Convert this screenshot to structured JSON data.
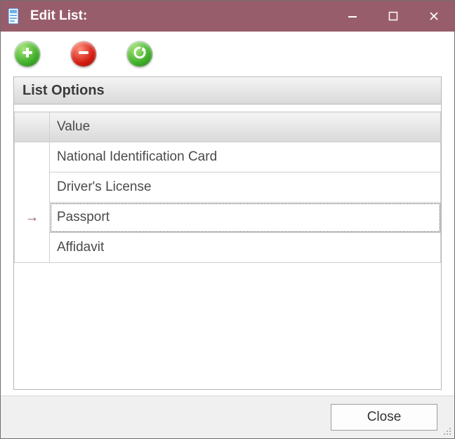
{
  "window": {
    "title": "Edit List:",
    "icons": {
      "app": "list-document-icon",
      "minimize": "minimize-icon",
      "maximize": "maximize-icon",
      "close": "close-icon"
    }
  },
  "toolbar": {
    "add": {
      "name": "add-button",
      "icon": "plus-icon",
      "color": "#3fae2a"
    },
    "remove": {
      "name": "remove-button",
      "icon": "minus-icon",
      "color": "#d11b0f"
    },
    "refresh": {
      "name": "refresh-button",
      "icon": "refresh-icon",
      "color": "#3fae2a"
    }
  },
  "panel": {
    "title": "List Options",
    "columns": {
      "indicator": "",
      "value": "Value"
    },
    "rows": [
      {
        "value": "National Identification Card",
        "selected": false
      },
      {
        "value": "Driver's License",
        "selected": false
      },
      {
        "value": "Passport",
        "selected": true
      },
      {
        "value": "Affidavit",
        "selected": false
      }
    ],
    "indicator_glyph": "→"
  },
  "footer": {
    "close_label": "Close"
  }
}
